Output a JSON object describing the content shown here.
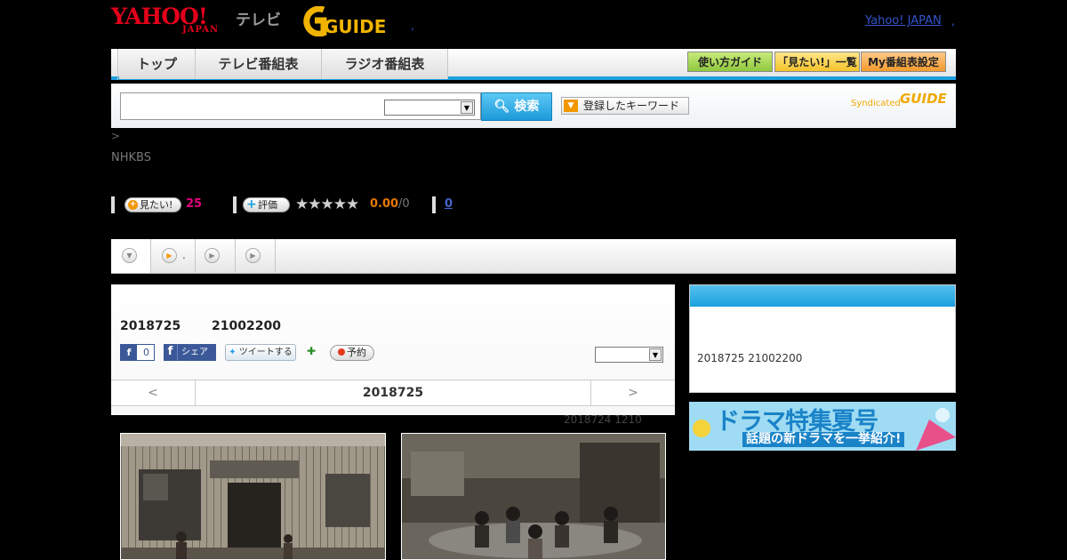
{
  "header": {
    "logo_yahoo": "YAHOO!",
    "logo_japan": "JAPAN",
    "logo_terebi": "テレビ",
    "logo_gguide": "GUIDE",
    "yahoo_japan_link": "Yahoo! JAPAN"
  },
  "nav": {
    "tabs": [
      {
        "label": "トップ"
      },
      {
        "label": "テレビ番組表"
      },
      {
        "label": "ラジオ番組表"
      }
    ],
    "buttons": [
      {
        "label": "使い方ガイド"
      },
      {
        "label": "「見たい!」一覧"
      },
      {
        "label": "My番組表設定"
      }
    ]
  },
  "search": {
    "input_value": "",
    "select_value": "",
    "button_label": "検索",
    "keyword_button_label": "登録したキーワード",
    "syndicated_label": "Syndicated",
    "syndicated_logo": "GUIDE"
  },
  "program": {
    "breadcrumb": ">",
    "station": "NHKBS",
    "mitai_label": "見たい!",
    "mitai_count": "25",
    "hyouka_label": "評価",
    "stars": "★★★★★",
    "rating": "0.00",
    "rating_total": "/0",
    "link_count": "0"
  },
  "tabs_strip": {
    "tab_labels": [
      "",
      ".",
      "",
      ""
    ]
  },
  "main_panel": {
    "air_date": "2018725",
    "air_time": "21002200",
    "fb_count": "0",
    "fb_share": "シェア",
    "tweet_label": "ツイートする",
    "yoyaku_label": "予約",
    "select_value": "",
    "prev_label": "<",
    "current_date": "2018725",
    "next_label": ">",
    "updated": "2018724  1210"
  },
  "sidebar": {
    "box_text": "2018725  21002200",
    "banner_title": "ドラマ特集夏号",
    "banner_subtitle": "話題の新ドラマを一挙紹介!"
  }
}
